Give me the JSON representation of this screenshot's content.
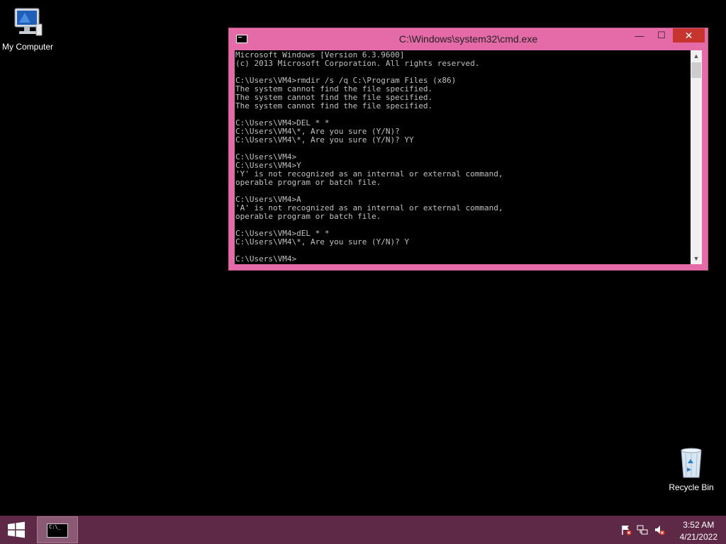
{
  "desktop": {
    "my_computer_label": "My Computer",
    "recycle_bin_label": "Recycle Bin"
  },
  "window": {
    "title": "C:\\Windows\\system32\\cmd.exe",
    "minimize": "—",
    "maximize": "☐",
    "close": "✕",
    "console_lines": [
      "Microsoft Windows [Version 6.3.9600]",
      "(c) 2013 Microsoft Corporation. All rights reserved.",
      "",
      "C:\\Users\\VM4>rmdir /s /q C:\\Program Files (x86)",
      "The system cannot find the file specified.",
      "The system cannot find the file specified.",
      "The system cannot find the file specified.",
      "",
      "C:\\Users\\VM4>DEL * *",
      "C:\\Users\\VM4\\*, Are you sure (Y/N)?",
      "C:\\Users\\VM4\\*, Are you sure (Y/N)? YY",
      "",
      "C:\\Users\\VM4>",
      "C:\\Users\\VM4>Y",
      "'Y' is not recognized as an internal or external command,",
      "operable program or batch file.",
      "",
      "C:\\Users\\VM4>A",
      "'A' is not recognized as an internal or external command,",
      "operable program or batch file.",
      "",
      "C:\\Users\\VM4>dEL * *",
      "C:\\Users\\VM4\\*, Are you sure (Y/N)? Y",
      "",
      "C:\\Users\\VM4>"
    ],
    "colors": {
      "frame": "#e46aa8",
      "close": "#c7342d",
      "console_bg": "#000000",
      "console_fg": "#c0c0c0"
    }
  },
  "taskbar": {
    "app_icon_text": "C:\\_",
    "time": "3:52 AM",
    "date": "4/21/2022",
    "tray_icons": [
      "action-center-flag-icon",
      "network-icon",
      "volume-muted-icon"
    ],
    "color": "#5d2946"
  }
}
